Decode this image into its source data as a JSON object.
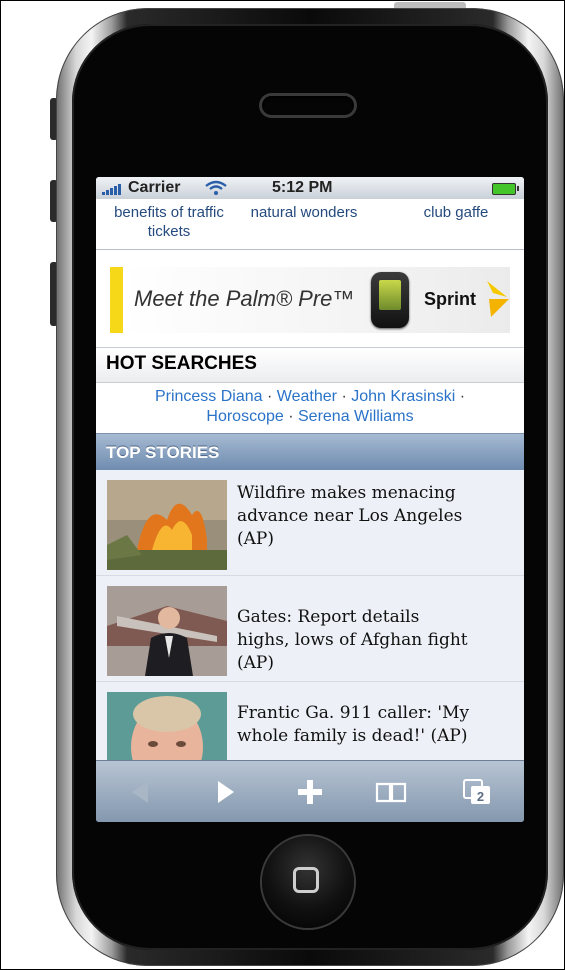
{
  "status_bar": {
    "carrier": "Carrier",
    "time": "5:12 PM"
  },
  "related_links": [
    {
      "line1": "benefits of traffic",
      "line2": "tickets"
    },
    {
      "line1": "natural wonders",
      "line2": ""
    },
    {
      "line1": "club gaffe",
      "line2": ""
    }
  ],
  "ad": {
    "headline": "Meet the Palm® Pre™",
    "brand": "Sprint",
    "accent_color": "#f6d818"
  },
  "hot_searches": {
    "title": "HOT SEARCHES",
    "links": [
      "Princess Diana",
      "Weather",
      "John Krasinski",
      "Horoscope",
      "Serena Williams"
    ]
  },
  "top_stories": {
    "title": "TOP STORIES",
    "items": [
      {
        "headline": "Wildfire makes menacing advance near Los Angeles (AP)",
        "thumb": "wildfire-photo"
      },
      {
        "headline": "Gates: Report details highs, lows of Afghan fight (AP)",
        "thumb": "gates-photo"
      },
      {
        "headline": "Frantic Ga. 911 caller: 'My whole family is dead!' (AP)",
        "thumb": "caller-photo"
      }
    ]
  },
  "toolbar": {
    "back_icon": "back-arrow-icon",
    "forward_icon": "forward-arrow-icon",
    "add_icon": "plus-icon",
    "bookmarks_icon": "bookmarks-book-icon",
    "pages_icon": "pages-icon",
    "pages_count": "2"
  }
}
